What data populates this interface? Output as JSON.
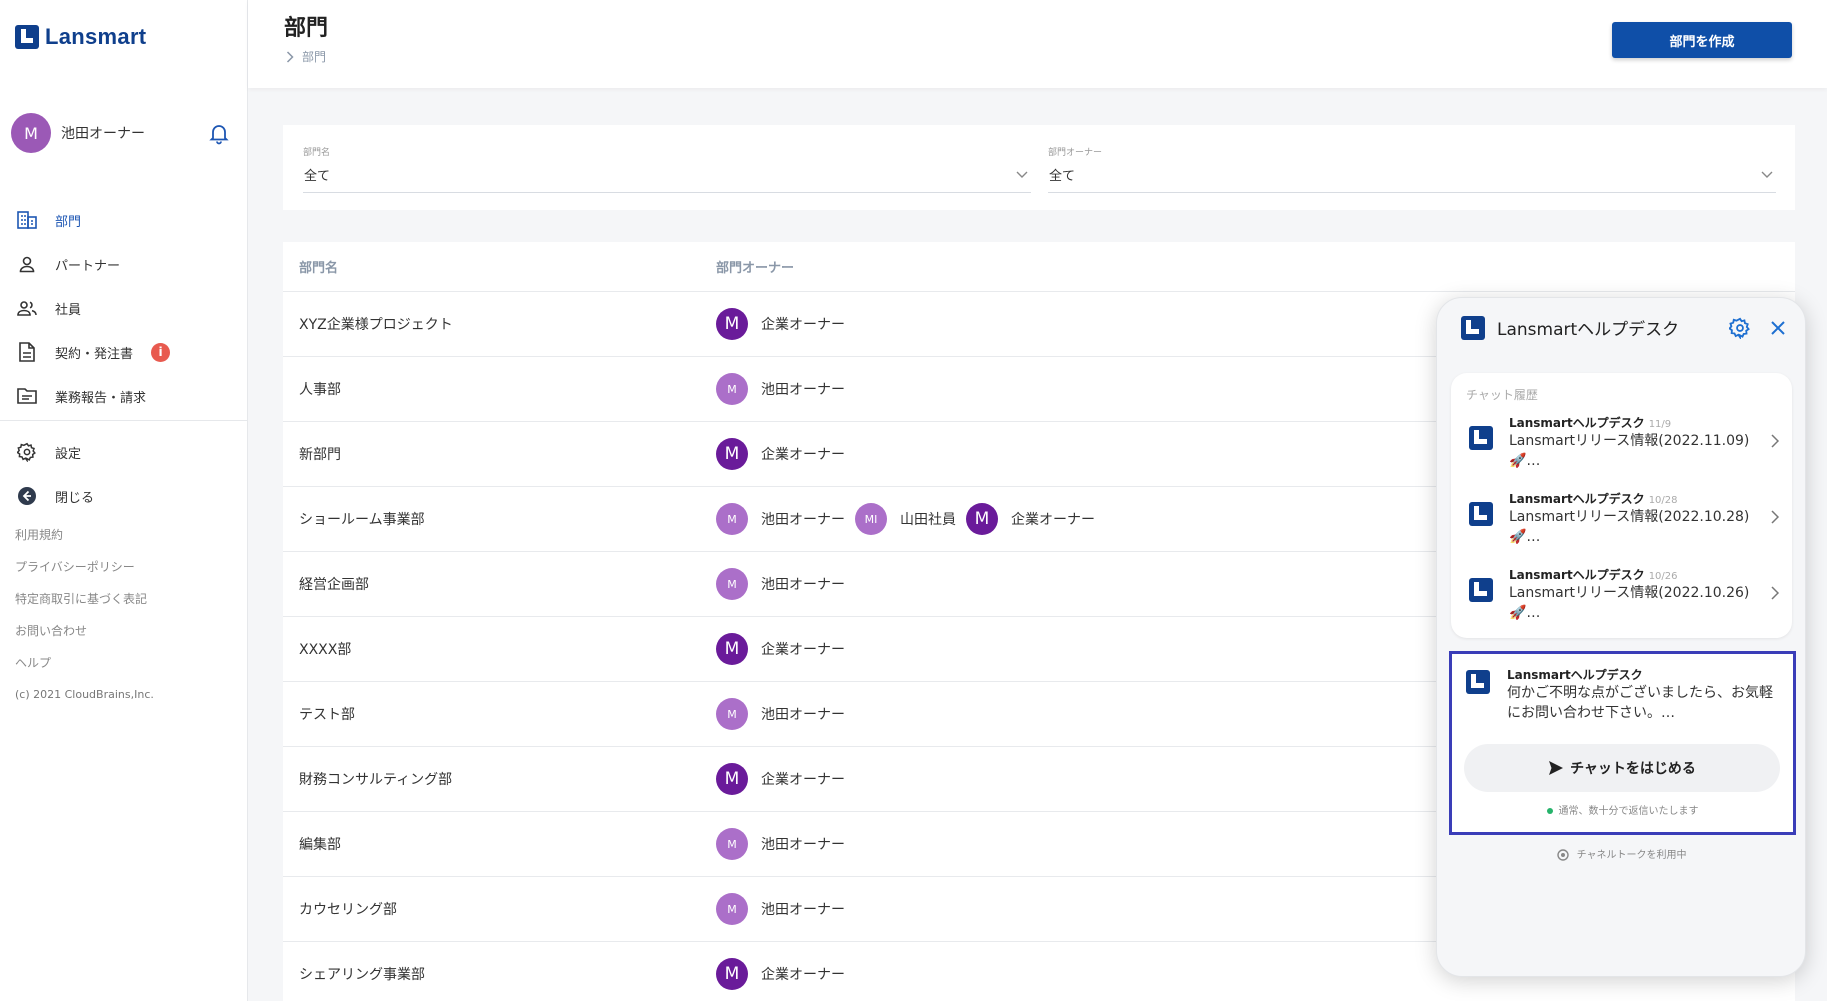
{
  "app": {
    "logo_text": "Lansmart"
  },
  "user": {
    "initial": "M",
    "name": "池田オーナー"
  },
  "nav": {
    "items": [
      {
        "label": "部門",
        "icon": "building-icon"
      },
      {
        "label": "パートナー",
        "icon": "person-icon"
      },
      {
        "label": "社員",
        "icon": "people-icon"
      },
      {
        "label": "契約・発注書",
        "icon": "document-icon",
        "badge": "i"
      },
      {
        "label": "業務報告・請求",
        "icon": "folder-icon"
      }
    ],
    "secondary": [
      {
        "label": "設定",
        "icon": "gear-icon"
      },
      {
        "label": "閉じる",
        "icon": "arrow-left-circle-icon"
      }
    ]
  },
  "footer": {
    "links": [
      "利用規約",
      "プライバシーポリシー",
      "特定商取引に基づく表記",
      "お問い合わせ",
      "ヘルプ"
    ],
    "copyright": "(c) 2021 CloudBrains,Inc."
  },
  "header": {
    "title": "部門",
    "breadcrumb": "部門",
    "create_button": "部門を作成"
  },
  "filters": [
    {
      "label": "部門名",
      "value": "全て"
    },
    {
      "label": "部門オーナー",
      "value": "全て"
    }
  ],
  "table": {
    "columns": [
      "部門名",
      "部門オーナー"
    ],
    "rows": [
      {
        "name": "XYZ企業様プロジェクト",
        "owners": [
          {
            "initial": "M",
            "name": "企業オーナー",
            "style": "dark"
          }
        ]
      },
      {
        "name": "人事部",
        "owners": [
          {
            "initial": "M",
            "name": "池田オーナー",
            "style": "light"
          }
        ]
      },
      {
        "name": "新部門",
        "owners": [
          {
            "initial": "M",
            "name": "企業オーナー",
            "style": "dark"
          }
        ]
      },
      {
        "name": "ショールーム事業部",
        "owners": [
          {
            "initial": "M",
            "name": "池田オーナー",
            "style": "light"
          },
          {
            "initial": "MI",
            "name": "山田社員",
            "style": "light"
          },
          {
            "initial": "M",
            "name": "企業オーナー",
            "style": "dark"
          }
        ]
      },
      {
        "name": "経営企画部",
        "owners": [
          {
            "initial": "M",
            "name": "池田オーナー",
            "style": "light"
          }
        ]
      },
      {
        "name": "XXXX部",
        "owners": [
          {
            "initial": "M",
            "name": "企業オーナー",
            "style": "dark"
          }
        ]
      },
      {
        "name": "テスト部",
        "owners": [
          {
            "initial": "M",
            "name": "池田オーナー",
            "style": "light"
          }
        ]
      },
      {
        "name": "財務コンサルティング部",
        "owners": [
          {
            "initial": "M",
            "name": "企業オーナー",
            "style": "dark"
          }
        ]
      },
      {
        "name": "編集部",
        "owners": [
          {
            "initial": "M",
            "name": "池田オーナー",
            "style": "light"
          }
        ]
      },
      {
        "name": "カウセリング部",
        "owners": [
          {
            "initial": "M",
            "name": "池田オーナー",
            "style": "light"
          }
        ]
      },
      {
        "name": "シェアリング事業部",
        "owners": [
          {
            "initial": "M",
            "name": "企業オーナー",
            "style": "dark"
          }
        ]
      }
    ]
  },
  "chat": {
    "title": "Lansmartヘルプデスク",
    "history_label": "チャット履歴",
    "history": [
      {
        "sender": "Lansmartヘルプデスク",
        "date": "11/9",
        "text": "Lansmartリリース情報(2022.11.09)🚀…"
      },
      {
        "sender": "Lansmartヘルプデスク",
        "date": "10/28",
        "text": "Lansmartリリース情報(2022.10.28)🚀…"
      },
      {
        "sender": "Lansmartヘルプデスク",
        "date": "10/26",
        "text": "Lansmartリリース情報(2022.10.26)🚀…"
      }
    ],
    "welcome_sender": "Lansmartヘルプデスク",
    "welcome_message": "何かご不明な点がございましたら、お気軽にお問い合わせ下さい。…",
    "start_button": "チャットをはじめる",
    "reply_note": "通常、数十分で返信いたします",
    "powered_by": "チャネルトークを利用中"
  },
  "colors": {
    "brand": "#0f3f8c",
    "primary_button": "#0f4fa8",
    "active_nav": "#1d56b3",
    "badge": "#e85a4f",
    "avatar_dark": "#6a1b9a",
    "avatar_light": "#ab6fc9"
  }
}
